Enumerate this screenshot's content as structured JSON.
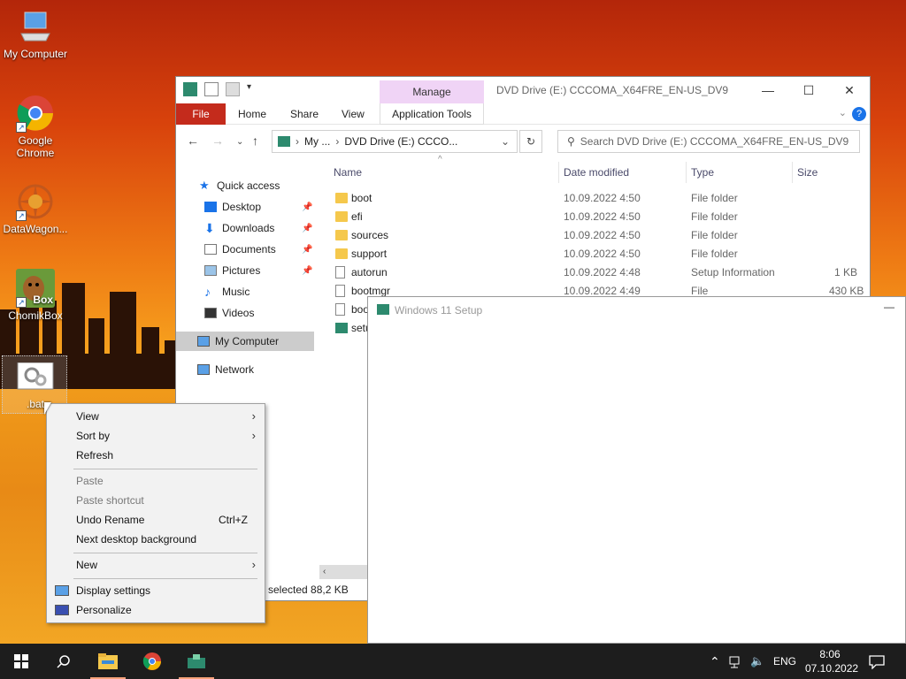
{
  "desktop": {
    "icons": [
      {
        "label": "My Computer"
      },
      {
        "label": "Google Chrome"
      },
      {
        "label": "DataWagon..."
      },
      {
        "label": "ChomikBox",
        "badge": "Box"
      },
      {
        "label": ".bat"
      }
    ]
  },
  "explorer": {
    "manage_tab": "Manage",
    "title": "DVD Drive (E:) CCCOMA_X64FRE_EN-US_DV9",
    "ribbon_tabs": [
      "File",
      "Home",
      "Share",
      "View",
      "Application Tools"
    ],
    "breadcrumb": [
      "My ...",
      "DVD Drive (E:) CCCO..."
    ],
    "search_placeholder": "Search DVD Drive (E:) CCCOMA_X64FRE_EN-US_DV9",
    "sidebar": {
      "quick_access": "Quick access",
      "items": [
        "Desktop",
        "Downloads",
        "Documents",
        "Pictures",
        "Music",
        "Videos"
      ],
      "my_computer": "My Computer",
      "network": "Network"
    },
    "columns": {
      "name": "Name",
      "date": "Date modified",
      "type": "Type",
      "size": "Size"
    },
    "files": [
      {
        "name": "boot",
        "date": "10.09.2022 4:50",
        "type": "File folder",
        "size": "",
        "kind": "folder"
      },
      {
        "name": "efi",
        "date": "10.09.2022 4:50",
        "type": "File folder",
        "size": "",
        "kind": "folder"
      },
      {
        "name": "sources",
        "date": "10.09.2022 4:50",
        "type": "File folder",
        "size": "",
        "kind": "folder"
      },
      {
        "name": "support",
        "date": "10.09.2022 4:50",
        "type": "File folder",
        "size": "",
        "kind": "folder"
      },
      {
        "name": "autorun",
        "date": "10.09.2022 4:48",
        "type": "Setup Information",
        "size": "1 KB",
        "kind": "doc"
      },
      {
        "name": "bootmgr",
        "date": "10.09.2022 4:49",
        "type": "File",
        "size": "430 KB",
        "kind": "doc"
      },
      {
        "name": "boo",
        "date": "",
        "type": "",
        "size": "",
        "kind": "doc"
      },
      {
        "name": "setu",
        "date": "",
        "type": "",
        "size": "",
        "kind": "setup"
      }
    ],
    "status": "n selected  88,2 KB"
  },
  "setup_window": {
    "title": "Windows 11 Setup"
  },
  "context_menu": {
    "items": [
      {
        "label": "View",
        "submenu": true
      },
      {
        "label": "Sort by",
        "submenu": true
      },
      {
        "label": "Refresh"
      },
      {
        "label": "Paste",
        "disabled": true
      },
      {
        "label": "Paste shortcut",
        "disabled": true
      },
      {
        "label": "Undo Rename",
        "shortcut": "Ctrl+Z"
      },
      {
        "label": "Next desktop background"
      },
      {
        "label": "New",
        "submenu": true
      },
      {
        "label": "Display settings"
      },
      {
        "label": "Personalize"
      }
    ]
  },
  "taskbar": {
    "language": "ENG",
    "time": "8:06",
    "date": "07.10.2022"
  },
  "colors": {
    "file_tab": "#c42b1c",
    "manage_tab": "#f0d4f6",
    "taskbar": "#1d1d1d",
    "folder": "#f5c84c"
  }
}
